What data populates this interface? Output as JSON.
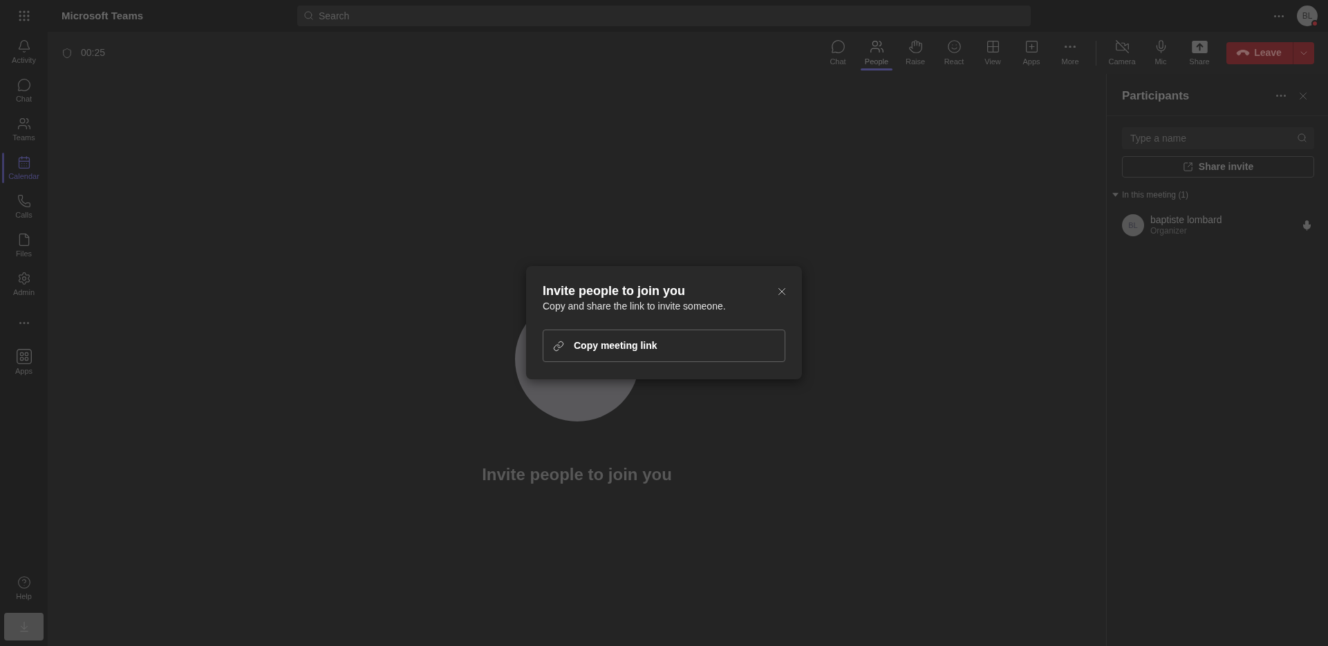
{
  "app_bar": {
    "title": "Microsoft Teams",
    "search": {
      "placeholder": "Search"
    },
    "account": {
      "initials": "BL"
    }
  },
  "left_rail": {
    "items": [
      {
        "label": "Activity",
        "selected": false
      },
      {
        "label": "Chat",
        "selected": false
      },
      {
        "label": "Teams",
        "selected": false
      },
      {
        "label": "Calendar",
        "selected": true
      },
      {
        "label": "Calls",
        "selected": false
      },
      {
        "label": "Files",
        "selected": false
      },
      {
        "label": "Admin",
        "selected": false
      }
    ],
    "apps": {
      "label": "Apps",
      "selected": false
    },
    "help": {
      "label": "Help"
    }
  },
  "meeting_bar": {
    "timer": "00:25",
    "actions": [
      {
        "label": "Chat",
        "selected": false
      },
      {
        "label": "People",
        "selected": true
      },
      {
        "label": "Raise",
        "selected": false
      },
      {
        "label": "React",
        "selected": false
      },
      {
        "label": "View",
        "selected": false
      },
      {
        "label": "Apps",
        "selected": false
      },
      {
        "label": "More",
        "selected": false
      }
    ],
    "devices": [
      {
        "label": "Camera",
        "on": false
      },
      {
        "label": "Mic",
        "on": true
      }
    ],
    "share": {
      "label": "Share"
    },
    "leave": {
      "label": "Leave"
    }
  },
  "stage": {
    "message": "Invite people to join you"
  },
  "invite_dialog": {
    "title": "Invite people to join you",
    "subtitle": "Copy and share the link to invite someone.",
    "button": "Copy meeting link"
  },
  "participants_panel": {
    "title": "Participants",
    "search": {
      "placeholder": "Type a name"
    },
    "share_button": "Share invite",
    "section": {
      "label": "In this meeting (1)",
      "expanded": true,
      "participants": [
        {
          "initials": "BL",
          "name": "baptiste lombard",
          "role": "Organizer",
          "mic_on": true
        }
      ]
    }
  }
}
